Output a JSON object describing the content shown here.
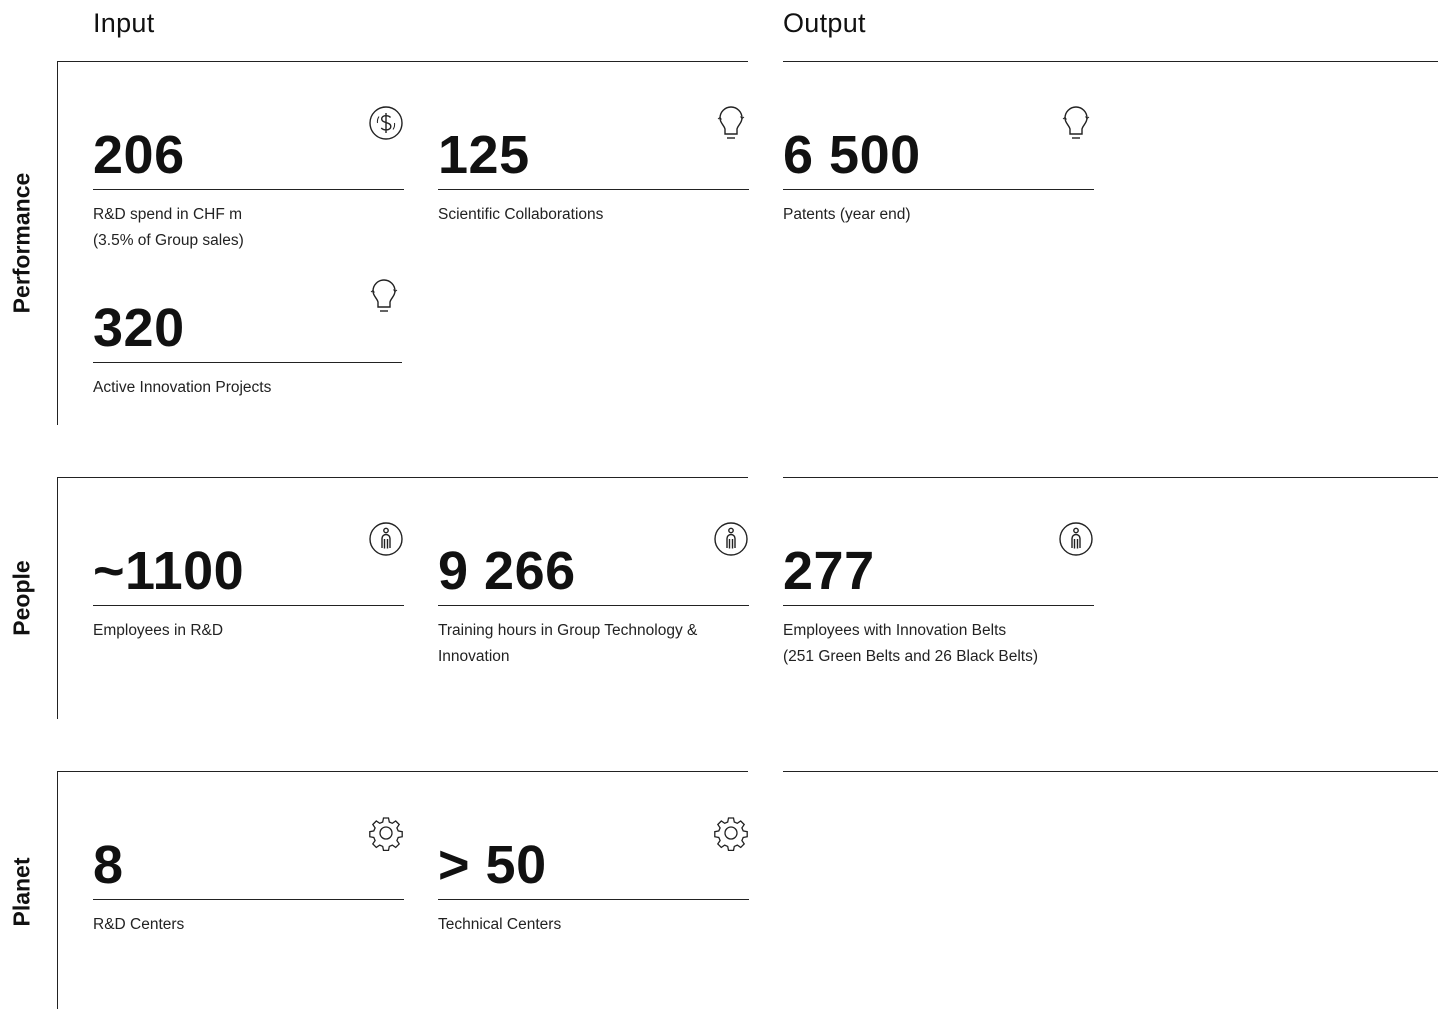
{
  "columns": {
    "input": "Input",
    "output": "Output"
  },
  "rows": {
    "performance": {
      "label": "Performance",
      "kpis": [
        {
          "value": "206",
          "lines": [
            "R&D spend in CHF m",
            "(3.5% of Group sales)"
          ],
          "icon": "dollar-icon"
        },
        {
          "value": "125",
          "lines": [
            "Scientific Collaborations"
          ],
          "icon": "lightbulb-icon"
        },
        {
          "value": "6 500",
          "lines": [
            "Patents (year end)"
          ],
          "icon": "lightbulb-icon"
        },
        {
          "value": "320",
          "lines": [
            "Active Innovation Projects"
          ],
          "icon": "lightbulb-icon"
        }
      ]
    },
    "people": {
      "label": "People",
      "kpis": [
        {
          "value": "~1100",
          "lines": [
            "Employees in R&D"
          ],
          "icon": "person-icon"
        },
        {
          "value": "9 266",
          "lines": [
            "Training hours in Group Technology &",
            "Innovation"
          ],
          "icon": "person-icon"
        },
        {
          "value": "277",
          "lines": [
            "Employees with Innovation Belts",
            "(251 Green Belts and 26 Black Belts)"
          ],
          "icon": "person-icon"
        }
      ]
    },
    "planet": {
      "label": "Planet",
      "kpis": [
        {
          "value": "8",
          "lines": [
            "R&D Centers"
          ],
          "icon": "gear-icon"
        },
        {
          "value": "> 50",
          "lines": [
            "Technical Centers"
          ],
          "icon": "gear-icon"
        }
      ]
    }
  }
}
